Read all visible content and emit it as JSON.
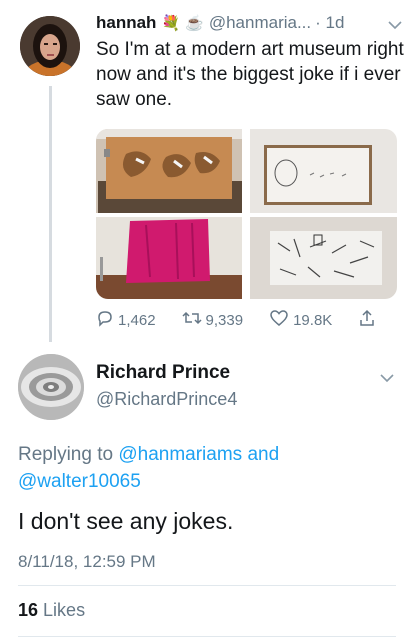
{
  "tweet": {
    "name": "hannah",
    "emoji1": "💐",
    "emoji2": "☕",
    "handle": "@hanmaria...",
    "time": "· 1d",
    "text": "So I'm at a modern art museum right now and it's the biggest joke if i ever saw one.",
    "replies": "1,462",
    "retweets": "9,339",
    "likes": "19.8K"
  },
  "reply_tweet": {
    "name": "Richard Prince",
    "handle": "@RichardPrince4",
    "replying_prefix": "Replying to",
    "mention1": "@hanmariams",
    "and_word": "and",
    "mention2": "@walter10065",
    "text": "I don't see any jokes.",
    "timestamp": "8/11/18, 12:59 PM",
    "likes_count": "16",
    "likes_label": "Likes"
  },
  "colors": {
    "link": "#1da1f2",
    "secondary_text": "#657786",
    "primary_text": "#14171a"
  },
  "icons": [
    "reply-icon",
    "retweet-icon",
    "like-icon",
    "share-icon",
    "chevron-down-icon"
  ]
}
